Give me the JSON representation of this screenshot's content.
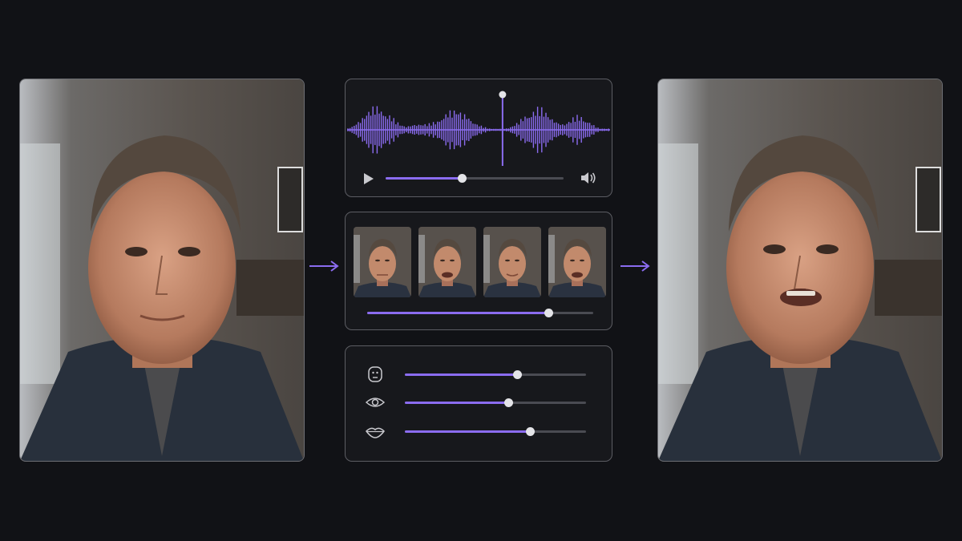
{
  "source_video": {
    "description_icon": "source-portrait"
  },
  "output_video": {
    "description_icon": "output-portrait"
  },
  "audio_panel": {
    "playhead_fraction": 0.59,
    "progress": 0.43
  },
  "frames_panel": {
    "frame_count": 4,
    "progress": 0.8
  },
  "controls_panel": {
    "sliders": [
      {
        "icon": "face-icon",
        "value": 0.62
      },
      {
        "icon": "eye-icon",
        "value": 0.57
      },
      {
        "icon": "lips-icon",
        "value": 0.69
      }
    ]
  },
  "colors": {
    "accent": "#8b6cf0",
    "background": "#111216",
    "panel": "#17181c",
    "track": "#4a4b52"
  }
}
